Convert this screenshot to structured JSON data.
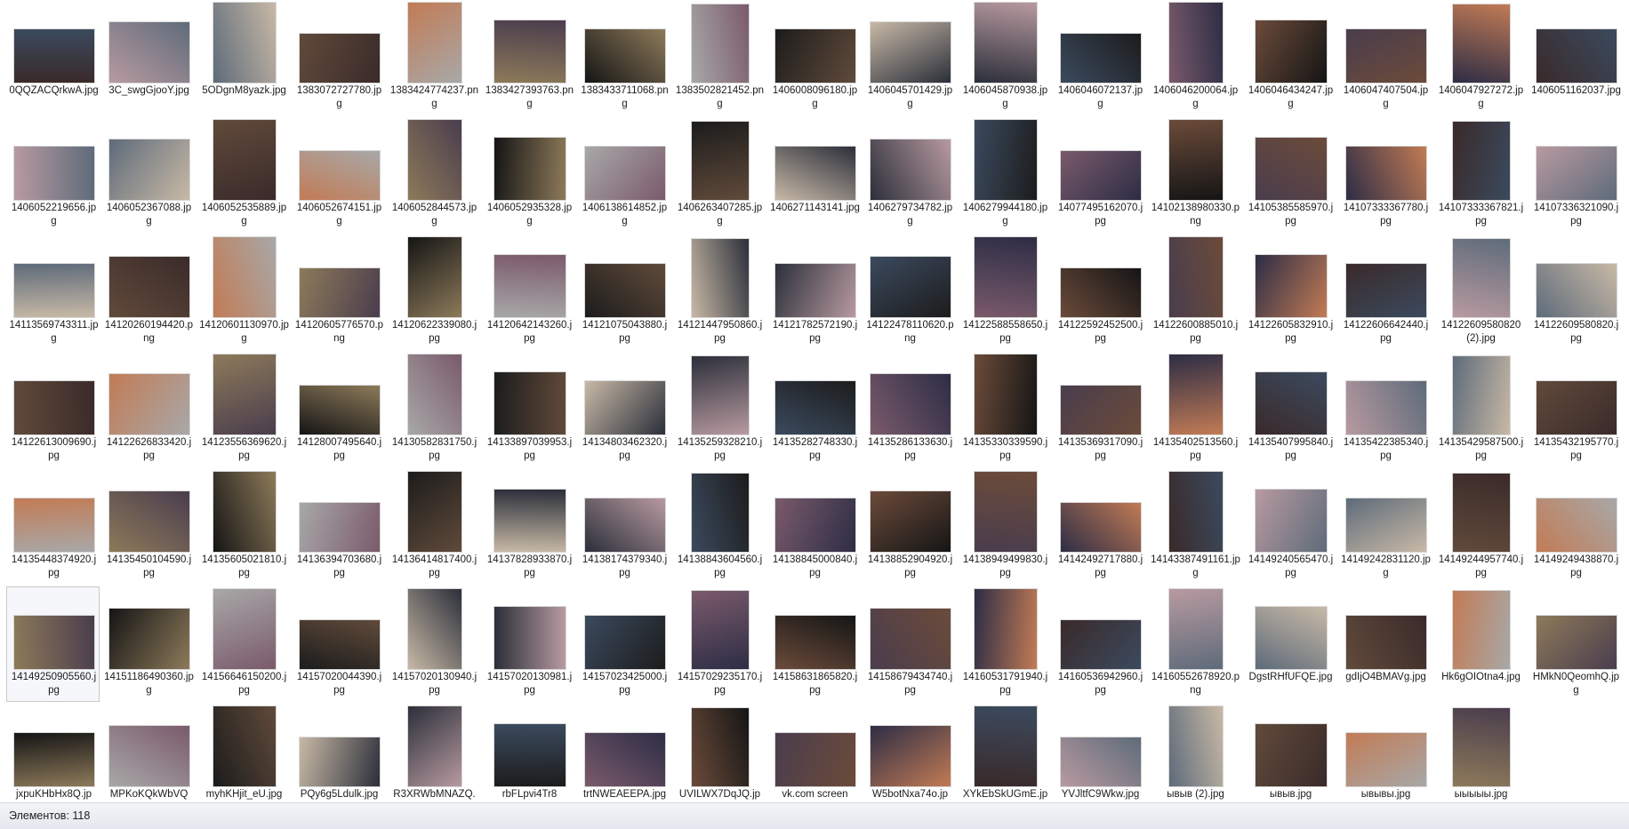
{
  "status_bar": {
    "item_count_text": "Элементов: 118"
  },
  "selected_index": 85,
  "files": [
    "0QQZACQrkwA.jpg",
    "3C_swgGjooY.jpg",
    "5ODgnM8yazk.jpg",
    "1383072727780.jpg",
    "1383424774237.png",
    "1383427393763.png",
    "1383433711068.png",
    "1383502821452.png",
    "1406008096180.jpg",
    "1406045701429.jpg",
    "1406045870938.jpg",
    "1406046072137.jpg",
    "1406046200064.jpg",
    "1406046434247.jpg",
    "1406047407504.jpg",
    "1406047927272.jpg",
    "1406051162037.jpg",
    "1406052219656.jpg",
    "1406052367088.jpg",
    "1406052535889.jpg",
    "1406052674151.jpg",
    "1406052844573.jpg",
    "1406052935328.jpg",
    "1406138614852.jpg",
    "1406263407285.jpg",
    "1406271143141.jpg",
    "1406279734782.jpg",
    "1406279944180.jpg",
    "1407749516207​0.jpg",
    "1410213898033​0.png",
    "1410538558597​0.jpg",
    "1410733336778​0.jpg",
    "1410733336782​1.jpg",
    "1410733632109​0.jpg",
    "14113569743311.jpg",
    "14120260194420.png",
    "14120601130970.jpg",
    "14120605776570.png",
    "14120622339080.jpg",
    "14120642143260.jpg",
    "14121075043880.jpg",
    "14121447950860.jpg",
    "14121782572190.jpg",
    "14122478110620.png",
    "14122588558650.jpg",
    "14122592452500.jpg",
    "14122600885010.jpg",
    "14122605832910.jpg",
    "14122606642440.jpg",
    "14122609580820 (2).jpg",
    "14122609580820.jpg",
    "14122613009690.jpg",
    "14122626833420.jpg",
    "14123556369620.jpg",
    "14128007495640.jpg",
    "14130582831750.jpg",
    "14133897039953.jpg",
    "14134803462320.jpg",
    "14135259328210.jpg",
    "14135282748330.jpg",
    "14135286133630.jpg",
    "14135330339590.jpg",
    "14135369317090.jpg",
    "14135402513560.jpg",
    "14135407995840.jpg",
    "14135422385340.jpg",
    "14135429587500.jpg",
    "14135432195770.jpg",
    "14135448374920.jpg",
    "14135450104590.jpg",
    "14135605021810.jpg",
    "14136394703680.jpg",
    "14136414817400.jpg",
    "14137828933870.jpg",
    "14138174379340.jpg",
    "14138843604560.jpg",
    "14138845000840.jpg",
    "14138852904920.jpg",
    "14138949499830.jpg",
    "14142492717880.jpg",
    "14143387491161.jpg",
    "14149240565470.jpg",
    "14149242831120.jpg",
    "14149244957740.jpg",
    "14149249438870.jpg",
    "14149250905560.jpg",
    "14151186490360.jpg",
    "14156646150200.jpg",
    "14157020044390.jpg",
    "14157020130940.jpg",
    "14157020130981.jpg",
    "14157023425000.jpg",
    "14157029235170.jpg",
    "14158631865820.jpg",
    "14158679434740.jpg",
    "14160531791940.jpg",
    "14160536942960.jpg",
    "14160552678920.png",
    "DgstRHfUFQE.jpg",
    "gdIjO4BMAVg.jpg",
    "Hk6gOIOtna4.jpg",
    "HMkN0QeomhQ.jpg",
    "jxpuKHbHx8Q.jp",
    "MPKoKQkWbVQ",
    "myhKHjit_eU.jpg",
    "PQy6g5Ldulk.jpg",
    "R3XRWbMNAZQ.",
    "rbFLpvi4Tr8",
    "trtNWEAEEPA.jpg",
    "UVILWX7DqJQ.jp",
    "vk.com screen",
    "W5botNxa74o.jp",
    "XYkEbSkUGmE.jp",
    "YVJltfC9Wkw.jpg",
    "ывыв (2).jpg",
    "ывыв.jpg",
    "ывывы.jpg",
    "ыыыыы.jpg"
  ],
  "colors": {
    "accent_selected": "#c9c9c9",
    "thumb_palette": [
      "#3a2a2a",
      "#6b4b3a",
      "#2b2f3a",
      "#a8a8a8",
      "#c27b55",
      "#b89aa0",
      "#4a3d4d",
      "#3b4a5e",
      "#1c1c1c",
      "#8d7a5a",
      "#5e6b7a",
      "#2d2d45",
      "#7a5a6b",
      "#c8b9a6",
      "#151515",
      "#604a3a"
    ]
  }
}
